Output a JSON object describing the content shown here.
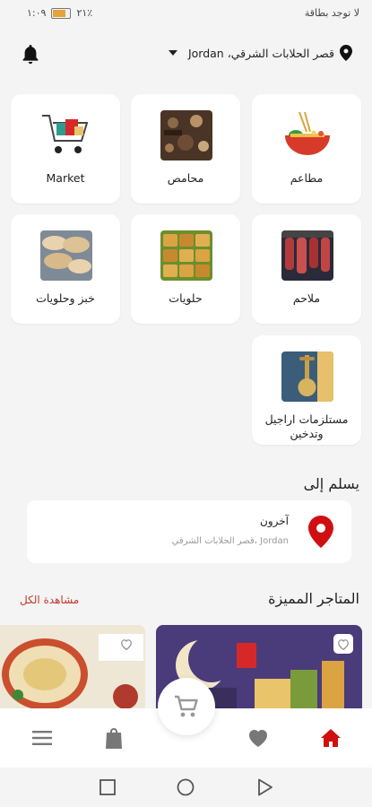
{
  "status_bar": {
    "time": "١:٠٩",
    "battery_text": "٢١٪",
    "network_text": "لا توجد بطاقة"
  },
  "header": {
    "location_text": "قصر الحلابات الشرقي، Jordan"
  },
  "categories": [
    {
      "label": "مطاعم"
    },
    {
      "label": "محامص"
    },
    {
      "label": "Market"
    },
    {
      "label": "ملاحم"
    },
    {
      "label": "حلويات"
    },
    {
      "label": "خبز وحلويات"
    },
    {
      "label": "مستلزمات اراجيل وتدخين"
    }
  ],
  "delivery": {
    "title": "يسلم إلى",
    "address_name": "آخرون",
    "address_line": "قصر الحلابات الشرقي، Jordan"
  },
  "featured": {
    "title": "المتاجر المميزة",
    "see_all": "مشاهدة الكل"
  },
  "colors": {
    "accent": "#c0392b",
    "background": "#f4f4f4",
    "card": "#ffffff",
    "nav_active": "#d01010",
    "nav_inactive": "#777777"
  },
  "icons": {
    "bell": "bell-icon",
    "pin": "location-pin-icon",
    "cart": "cart-icon",
    "home": "home-icon",
    "heart": "heart-icon",
    "bag": "shopping-bag-icon",
    "menu": "menu-icon"
  }
}
